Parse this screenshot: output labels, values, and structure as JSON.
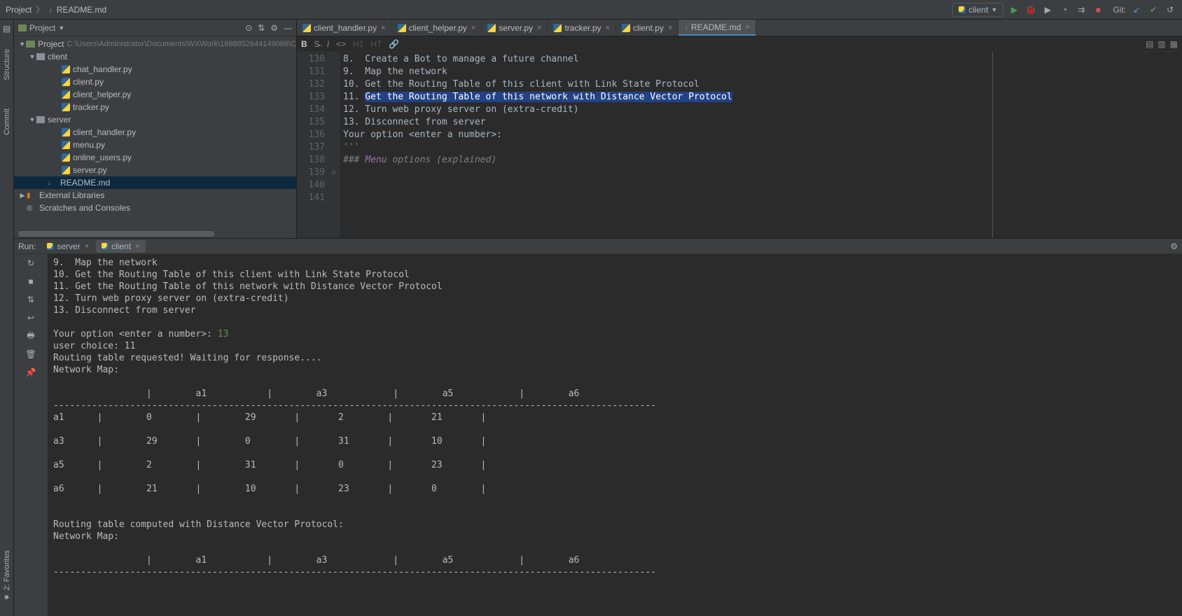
{
  "breadcrumb": {
    "project": "Project",
    "file_icon": "MD",
    "file": "README.md"
  },
  "run_config": {
    "name": "client"
  },
  "git_label": "Git:",
  "project_pane": {
    "title": "Project",
    "root": {
      "name": "Project",
      "path": "C:\\Users\\Administrator\\Documents\\WXWork\\1688852644149086\\C"
    },
    "client_folder": "client",
    "client_files": [
      "chat_handler.py",
      "client.py",
      "client_helper.py",
      "tracker.py"
    ],
    "server_folder": "server",
    "server_files": [
      "client_handler.py",
      "menu.py",
      "online_users.py",
      "server.py"
    ],
    "readme": "README.md",
    "external": "External Libraries",
    "scratches": "Scratches and Consoles"
  },
  "tabs": [
    "client_handler.py",
    "client_helper.py",
    "server.py",
    "tracker.py",
    "client.py",
    "README.md"
  ],
  "active_tab": 5,
  "editor": {
    "line_numbers": [
      "130",
      "131",
      "132",
      "133",
      "134",
      "135",
      "136",
      "137",
      "138",
      "139",
      "140",
      "141"
    ],
    "lines": [
      "8.  Create a Bot to manage a future channel",
      "9.  Map the network",
      "10. Get the Routing Table of this client with Link State Protocol",
      "11. Get the Routing Table of this network with Distance Vector Protocol",
      "12. Turn web proxy server on (extra-credit)",
      "13. Disconnect from server",
      "",
      "Your option <enter a number>:",
      "",
      "'''",
      "",
      "### Menu options (explained)"
    ],
    "selected_line_index": 3,
    "selected_text": "Get the Routing Table of this network with Distance Vector Protocol",
    "selected_prefix": "11. "
  },
  "run": {
    "label": "Run:",
    "tabs": [
      "server",
      "client"
    ],
    "active": 1,
    "console_lines": [
      "9.  Map the network",
      "10. Get the Routing Table of this client with Link State Protocol",
      "11. Get the Routing Table of this network with Distance Vector Protocol",
      "12. Turn web proxy server on (extra-credit)",
      "13. Disconnect from server",
      "",
      "Your option <enter a number>: 13",
      "user choice: 11",
      "Routing table requested! Waiting for response....",
      "Network Map:",
      "",
      "                 |        a1           |        a3            |        a5            |        a6",
      "--------------------------------------------------------------------------------------------------------------",
      "a1      |        0        |        29       |       2        |       21       |",
      "",
      "a3      |        29       |        0        |       31       |       10       |",
      "",
      "a5      |        2        |        31       |       0        |       23       |",
      "",
      "a6      |        21       |        10       |       23       |       0        |",
      "",
      "",
      "Routing table computed with Distance Vector Protocol:",
      "Network Map:",
      "",
      "                 |        a1           |        a3            |        a5            |        a6",
      "--------------------------------------------------------------------------------------------------------------"
    ],
    "input_value": "13"
  }
}
